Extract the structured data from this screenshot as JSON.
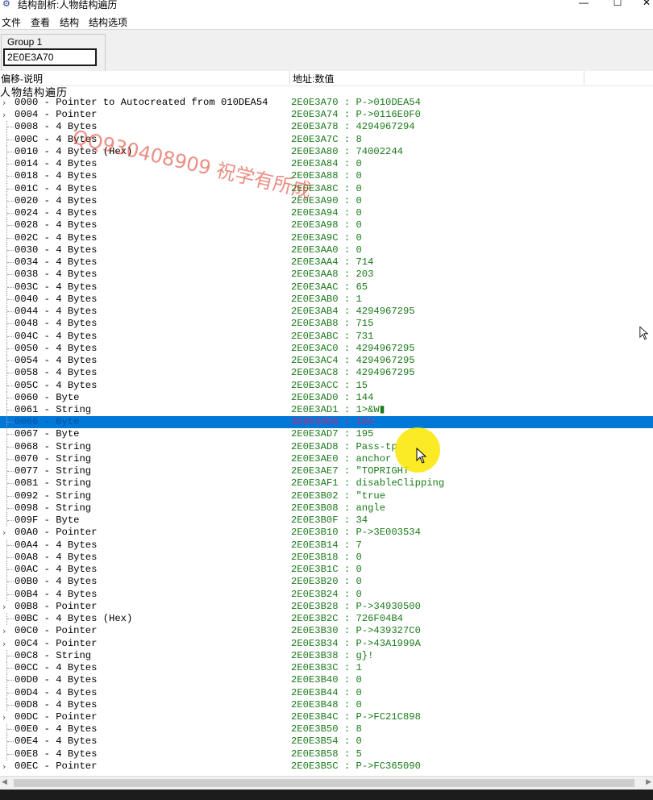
{
  "window": {
    "title": "结构剖析:人物结构遍历",
    "minimize_glyph": "—",
    "maximize_glyph": "☐",
    "close_glyph": "✕"
  },
  "menu": [
    {
      "label": "文件"
    },
    {
      "label": "查看"
    },
    {
      "label": "结构"
    },
    {
      "label": "结构选项"
    }
  ],
  "group": {
    "label": "Group 1",
    "address_value": "2E0E3A70"
  },
  "columns": {
    "offset_desc": "偏移-说明",
    "address_value": "地址:数值"
  },
  "structure_name": "人物结构遍历",
  "watermark": "QQ930408909 祝学有所成",
  "selected_row_index": 26,
  "rows": [
    {
      "desc": "0000 - Pointer to Autocreated from 010DEA54",
      "addr": "2E0E3A70 : P->010DEA54",
      "expand": true
    },
    {
      "desc": "0004 - Pointer",
      "addr": "2E0E3A74 : P->0116E0F0",
      "expand": true
    },
    {
      "desc": "0008 - 4 Bytes",
      "addr": "2E0E3A78 : 4294967294",
      "expand": false
    },
    {
      "desc": "000C - 4 Bytes",
      "addr": "2E0E3A7C : 8",
      "expand": false
    },
    {
      "desc": "0010 - 4 Bytes (Hex)",
      "addr": "2E0E3A80 : 74002244",
      "expand": false
    },
    {
      "desc": "0014 - 4 Bytes",
      "addr": "2E0E3A84 : 0",
      "expand": false
    },
    {
      "desc": "0018 - 4 Bytes",
      "addr": "2E0E3A88 : 0",
      "expand": false
    },
    {
      "desc": "001C - 4 Bytes",
      "addr": "2E0E3A8C : 0",
      "expand": false
    },
    {
      "desc": "0020 - 4 Bytes",
      "addr": "2E0E3A90 : 0",
      "expand": false
    },
    {
      "desc": "0024 - 4 Bytes",
      "addr": "2E0E3A94 : 0",
      "expand": false
    },
    {
      "desc": "0028 - 4 Bytes",
      "addr": "2E0E3A98 : 0",
      "expand": false
    },
    {
      "desc": "002C - 4 Bytes",
      "addr": "2E0E3A9C : 0",
      "expand": false
    },
    {
      "desc": "0030 - 4 Bytes",
      "addr": "2E0E3AA0 : 0",
      "expand": false
    },
    {
      "desc": "0034 - 4 Bytes",
      "addr": "2E0E3AA4 : 714",
      "expand": false
    },
    {
      "desc": "0038 - 4 Bytes",
      "addr": "2E0E3AA8 : 203",
      "expand": false
    },
    {
      "desc": "003C - 4 Bytes",
      "addr": "2E0E3AAC : 65",
      "expand": false
    },
    {
      "desc": "0040 - 4 Bytes",
      "addr": "2E0E3AB0 : 1",
      "expand": false
    },
    {
      "desc": "0044 - 4 Bytes",
      "addr": "2E0E3AB4 : 4294967295",
      "expand": false
    },
    {
      "desc": "0048 - 4 Bytes",
      "addr": "2E0E3AB8 : 715",
      "expand": false
    },
    {
      "desc": "004C - 4 Bytes",
      "addr": "2E0E3ABC : 731",
      "expand": false
    },
    {
      "desc": "0050 - 4 Bytes",
      "addr": "2E0E3AC0 : 4294967295",
      "expand": false
    },
    {
      "desc": "0054 - 4 Bytes",
      "addr": "2E0E3AC4 : 4294967295",
      "expand": false
    },
    {
      "desc": "0058 - 4 Bytes",
      "addr": "2E0E3AC8 : 4294967295",
      "expand": false
    },
    {
      "desc": "005C - 4 Bytes",
      "addr": "2E0E3ACC : 15",
      "expand": false
    },
    {
      "desc": "0060 - Byte",
      "addr": "2E0E3AD0 : 144",
      "expand": false
    },
    {
      "desc": "0061 - String",
      "addr": "2E0E3AD1 : 1>&W▮",
      "expand": false
    },
    {
      "desc": "0066 - Byte",
      "addr": "2E0E3AD6 : 154",
      "expand": false
    },
    {
      "desc": "0067 - Byte",
      "addr": "2E0E3AD7 : 195",
      "expand": false
    },
    {
      "desc": "0068 - String",
      "addr": "2E0E3AD8 : Pass-tp",
      "expand": false
    },
    {
      "desc": "0070 - String",
      "addr": "2E0E3AE0 : anchor",
      "expand": false
    },
    {
      "desc": "0077 - String",
      "addr": "2E0E3AE7 : \"TOPRIGHT",
      "expand": false
    },
    {
      "desc": "0081 - String",
      "addr": "2E0E3AF1 :  disableClipping",
      "expand": false
    },
    {
      "desc": "0092 - String",
      "addr": "2E0E3B02 : \"true",
      "expand": false
    },
    {
      "desc": "0098 - String",
      "addr": "2E0E3B08 :  angle",
      "expand": false
    },
    {
      "desc": "009F - Byte",
      "addr": "2E0E3B0F : 34",
      "expand": false
    },
    {
      "desc": "00A0 - Pointer",
      "addr": "2E0E3B10 : P->3E003534",
      "expand": true
    },
    {
      "desc": "00A4 - 4 Bytes",
      "addr": "2E0E3B14 : 7",
      "expand": false
    },
    {
      "desc": "00A8 - 4 Bytes",
      "addr": "2E0E3B18 : 0",
      "expand": false
    },
    {
      "desc": "00AC - 4 Bytes",
      "addr": "2E0E3B1C : 0",
      "expand": false
    },
    {
      "desc": "00B0 - 4 Bytes",
      "addr": "2E0E3B20 : 0",
      "expand": false
    },
    {
      "desc": "00B4 - 4 Bytes",
      "addr": "2E0E3B24 : 0",
      "expand": false
    },
    {
      "desc": "00B8 - Pointer",
      "addr": "2E0E3B28 : P->34930500",
      "expand": true
    },
    {
      "desc": "00BC - 4 Bytes (Hex)",
      "addr": "2E0E3B2C : 726F04B4",
      "expand": false
    },
    {
      "desc": "00C0 - Pointer",
      "addr": "2E0E3B30 : P->439327C0",
      "expand": true
    },
    {
      "desc": "00C4 - Pointer",
      "addr": "2E0E3B34 : P->43A1999A",
      "expand": true
    },
    {
      "desc": "00C8 - String",
      "addr": "2E0E3B38 :  g}!",
      "expand": false
    },
    {
      "desc": "00CC - 4 Bytes",
      "addr": "2E0E3B3C : 1",
      "expand": false
    },
    {
      "desc": "00D0 - 4 Bytes",
      "addr": "2E0E3B40 : 0",
      "expand": false
    },
    {
      "desc": "00D4 - 4 Bytes",
      "addr": "2E0E3B44 : 0",
      "expand": false
    },
    {
      "desc": "00D8 - 4 Bytes",
      "addr": "2E0E3B48 : 0",
      "expand": false
    },
    {
      "desc": "00DC - Pointer",
      "addr": "2E0E3B4C : P->FC21C898",
      "expand": true
    },
    {
      "desc": "00E0 - 4 Bytes",
      "addr": "2E0E3B50 : 8",
      "expand": false
    },
    {
      "desc": "00E4 - 4 Bytes",
      "addr": "2E0E3B54 : 0",
      "expand": false
    },
    {
      "desc": "00E8 - 4 Bytes",
      "addr": "2E0E3B58 : 5",
      "expand": false
    },
    {
      "desc": "00EC - Pointer",
      "addr": "2E0E3B5C : P->FC365090",
      "expand": true
    }
  ],
  "colors": {
    "selection": "#0078d7",
    "address_text": "#1a7a1a",
    "desc_text": "#000000",
    "watermark": "#dc321e",
    "cursor_halo": "#fae600"
  }
}
